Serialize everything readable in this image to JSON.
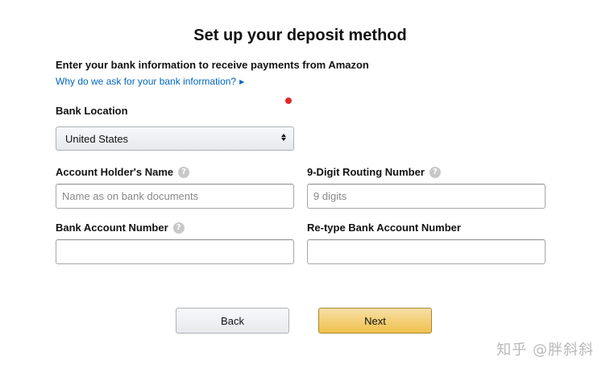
{
  "page": {
    "title": "Set up your deposit method",
    "subtitle": "Enter your bank information to receive payments from Amazon",
    "why_link": "Why do we ask for your bank information?"
  },
  "form": {
    "bank_location": {
      "label": "Bank Location",
      "selected": "United States"
    },
    "account_holder": {
      "label": "Account Holder's Name",
      "placeholder": "Name as on bank documents",
      "value": ""
    },
    "routing_number": {
      "label": "9-Digit Routing Number",
      "placeholder": "9 digits",
      "value": ""
    },
    "account_number": {
      "label": "Bank Account Number",
      "value": ""
    },
    "retype_account_number": {
      "label": "Re-type Bank Account Number",
      "value": ""
    },
    "help_glyph": "?"
  },
  "buttons": {
    "back": "Back",
    "next": "Next"
  },
  "watermark": "知乎 @胖斜斜",
  "colors": {
    "link": "#0066c0",
    "next_button": "#f0c14b",
    "required_dot": "#e4262b"
  },
  "icons": {
    "help": "help-circle-icon",
    "link_caret": "caret-right-icon",
    "select_arrows": "select-arrows-icon"
  }
}
